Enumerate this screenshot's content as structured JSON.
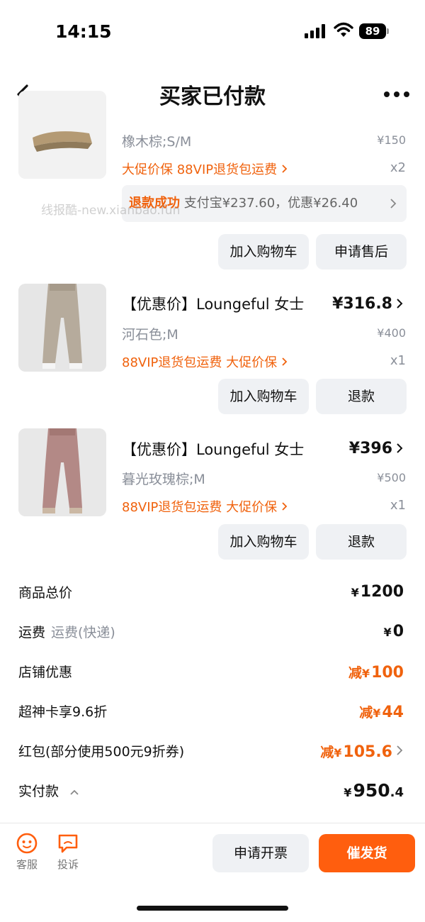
{
  "status_bar": {
    "time": "14:15",
    "battery": "89"
  },
  "nav": {
    "title": "买家已付款"
  },
  "watermark": "线报酷-new.xianbao.fun",
  "items": [
    {
      "name": "",
      "spec": "橡木棕;S/M",
      "original_price": "¥150",
      "tags": "大促价保  88VIP退货包运费",
      "qty": "x2",
      "refund_status": "退款成功",
      "refund_detail": "支付宝¥237.60，优惠¥26.40",
      "buttons": [
        "加入购物车",
        "申请售后"
      ]
    },
    {
      "name": "【优惠价】Loungeful 女士",
      "price": "¥316.8",
      "spec": "河石色;M",
      "original_price": "¥400",
      "tags": "88VIP退货包运费  大促价保",
      "qty": "x1",
      "buttons": [
        "加入购物车",
        "退款"
      ]
    },
    {
      "name": "【优惠价】Loungeful 女士",
      "price": "¥396",
      "spec": "暮光玫瑰棕;M",
      "original_price": "¥500",
      "tags": "88VIP退货包运费  大促价保",
      "qty": "x1",
      "buttons": [
        "加入购物车",
        "退款"
      ]
    }
  ],
  "summary": {
    "goods_total": {
      "label": "商品总价",
      "yen": "¥",
      "value": "1200"
    },
    "shipping": {
      "label": "运费",
      "sub": "运费(快递)",
      "yen": "¥",
      "value": "0"
    },
    "store_discount": {
      "label": "店铺优惠",
      "prefix": "减",
      "yen": "¥",
      "value": "100"
    },
    "card_discount": {
      "label": "超神卡享9.6折",
      "prefix": "减",
      "yen": "¥",
      "value": "44"
    },
    "red_packet": {
      "label": "红包(部分使用500元9折券)",
      "prefix": "减",
      "yen": "¥",
      "value": "105.6"
    },
    "paid": {
      "label": "实付款",
      "yen": "¥",
      "value": "950",
      "decimal": ".4"
    }
  },
  "bottom": {
    "service_label": "客服",
    "complaint_label": "投诉",
    "invoice_label": "申请开票",
    "urge_label": "催发货"
  },
  "colors": {
    "accent": "#ff5e0e",
    "orange_text": "#f0620d",
    "gray_text": "#8a8f99",
    "button_bg": "#eff1f4"
  }
}
